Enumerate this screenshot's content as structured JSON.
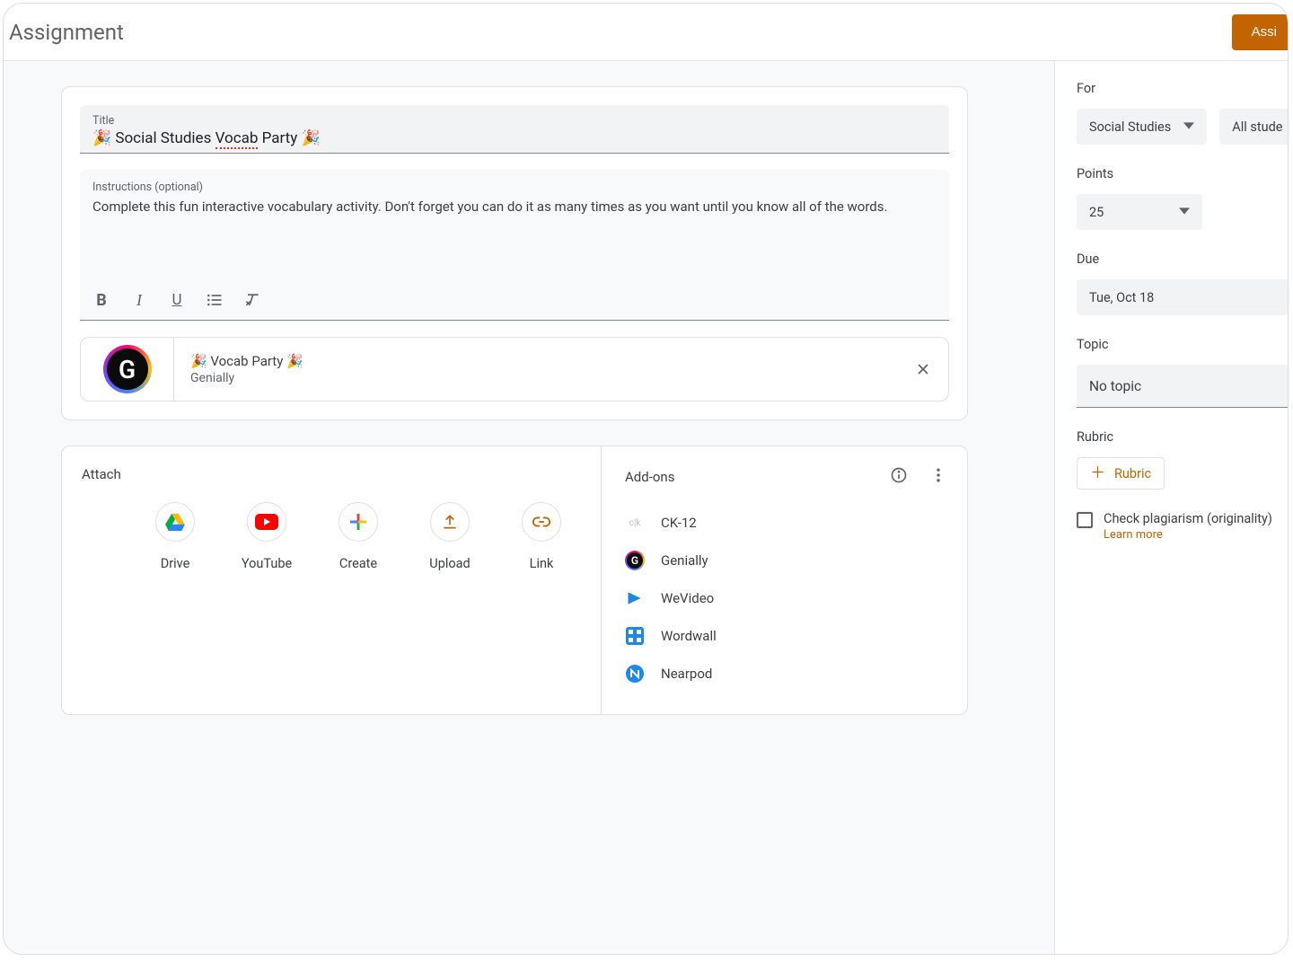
{
  "header": {
    "title": "Assignment",
    "assign_label": "Assi"
  },
  "form": {
    "title_label": "Title",
    "title_value_pre": "🎉 Social Studies ",
    "title_value_mis": "Vocab",
    "title_value_post": " Party 🎉",
    "instructions_label": "Instructions (optional)",
    "instructions_value": "Complete this fun interactive vocabulary activity. Don't forget you can do it as many times as you want until you know all of the words."
  },
  "attachment": {
    "title": "🎉 Vocab Party 🎉",
    "source": "Genially"
  },
  "attach": {
    "header": "Attach",
    "items": [
      {
        "label": "Drive"
      },
      {
        "label": "YouTube"
      },
      {
        "label": "Create"
      },
      {
        "label": "Upload"
      },
      {
        "label": "Link"
      }
    ]
  },
  "addons": {
    "header": "Add-ons",
    "items": [
      {
        "label": "CK-12"
      },
      {
        "label": "Genially"
      },
      {
        "label": "WeVideo"
      },
      {
        "label": "Wordwall"
      },
      {
        "label": "Nearpod"
      }
    ]
  },
  "side": {
    "for_label": "For",
    "for_class": "Social Studies",
    "for_students": "All stude",
    "points_label": "Points",
    "points_value": "25",
    "due_label": "Due",
    "due_value": "Tue, Oct 18",
    "topic_label": "Topic",
    "topic_value": "No topic",
    "rubric_label": "Rubric",
    "rubric_button": "Rubric",
    "plagiarism_label": "Check plagiarism (originality)",
    "learn_more": "Learn more"
  }
}
